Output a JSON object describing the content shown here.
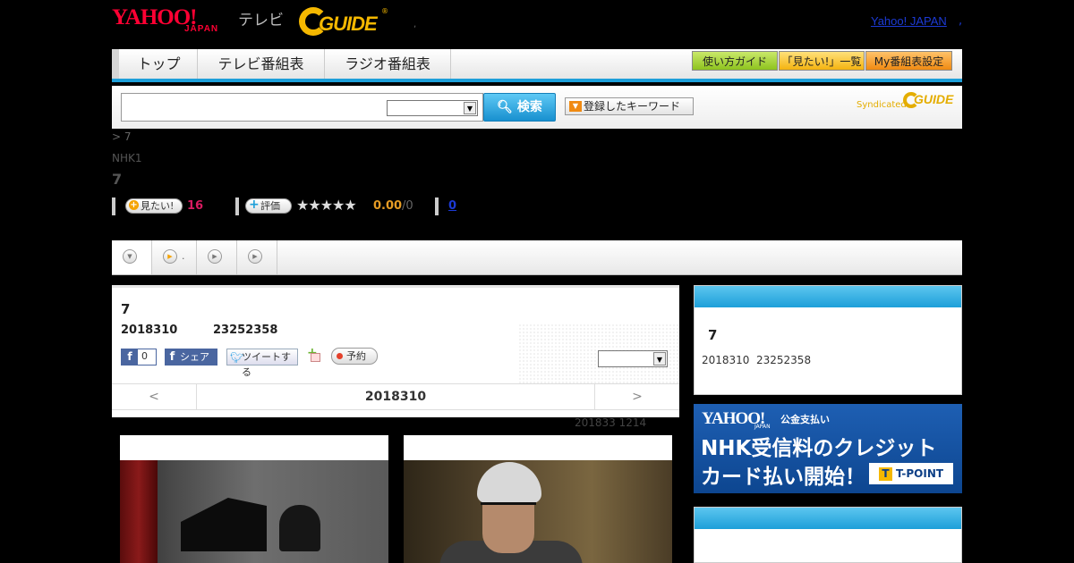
{
  "header": {
    "logo_yahoo": "YAHOO!",
    "logo_japan": "JAPAN",
    "logo_tv": "テレビ",
    "logo_gguide": "GUIDE",
    "logo_gguide_reg": "®",
    "header_dot": ",",
    "yahoo_japan_link": "Yahoo! JAPAN",
    "link_dot": ","
  },
  "nav": {
    "tabs": [
      {
        "label": "トップ"
      },
      {
        "label": "テレビ番組表"
      },
      {
        "label": "ラジオ番組表"
      }
    ],
    "buttons": [
      {
        "label": "使い方ガイド",
        "color": "#8dc31e"
      },
      {
        "label": "「見たい!」一覧",
        "color": "#f4b310"
      },
      {
        "label": "My番組表設定",
        "color": "#f08a12"
      }
    ],
    "accent": "#1d9fd9"
  },
  "search": {
    "input_value": "",
    "select_value": "",
    "search_button": "検索",
    "keyword_button": "登録したキーワード",
    "syndicated": "Syndicated",
    "syndicated_logo": "GUIDE"
  },
  "program": {
    "breadcrumb": "> 7",
    "station": "NHK1",
    "title": "7",
    "want_button": "見たい!",
    "want_count": "16",
    "rate_button": "評価",
    "stars": "★★★★★",
    "rating": "0.00",
    "rating_total": "/0",
    "comment_count": "0"
  },
  "tabs": {
    "tab2_text": "."
  },
  "main": {
    "title": "7",
    "date": "2018310",
    "time": "23252358",
    "fb_count": "0",
    "fb_share": "シェア",
    "tweet": "ツイートする",
    "reserve": "予約",
    "select_value": "",
    "prev": "<",
    "nav_date": "2018310",
    "next": ">",
    "updated": "201833  1214"
  },
  "sidebar": {
    "title": "7",
    "date": "2018310",
    "time": "23252358",
    "banner": {
      "yahoo": "YAHOO!",
      "japan": "JAPAN",
      "service": "公金支払い",
      "line1": "NHK受信料のクレジット",
      "line2": "カード払い開始！",
      "tpoint": "T-POINT"
    }
  }
}
